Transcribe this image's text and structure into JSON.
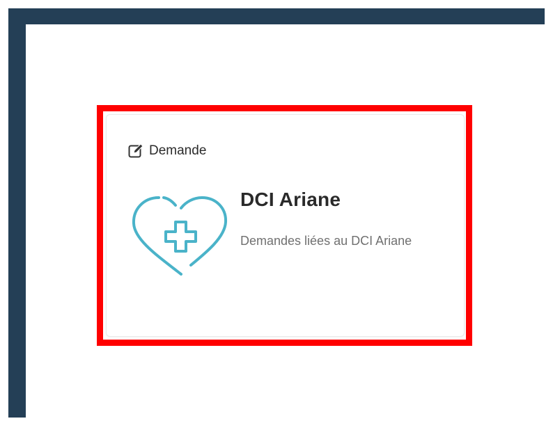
{
  "card": {
    "type_label": "Demande",
    "type_icon": "edit-icon",
    "title": "DCI Ariane",
    "description": "Demandes liées au DCI Ariane",
    "illustration": "heart-medical-cross-icon",
    "accent_color": "#4ab3c9"
  },
  "colors": {
    "frame": "#243f56",
    "highlight": "#ff0000"
  }
}
